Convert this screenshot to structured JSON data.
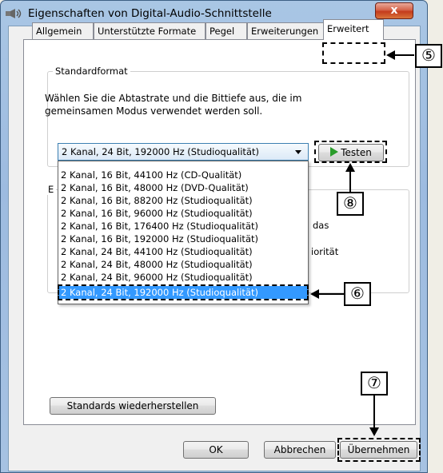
{
  "window": {
    "title": "Eigenschaften von Digital-Audio-Schnittstelle",
    "close_label": "x"
  },
  "tabs": [
    {
      "label": "Allgemein"
    },
    {
      "label": "Unterstützte Formate"
    },
    {
      "label": "Pegel"
    },
    {
      "label": "Erweiterungen"
    },
    {
      "label": "Erweitert"
    }
  ],
  "standardformat": {
    "legend": "Standardformat",
    "description": "Wählen Sie die Abtastrate und die Bittiefe aus, die im gemeinsamen Modus verwendet werden soll.",
    "selected_value": "2 Kanal, 24 Bit, 192000 Hz (Studioqualität)",
    "test_button": "Testen"
  },
  "dropdown": {
    "options": [
      "2 Kanal, 16 Bit, 44100 Hz (CD-Qualität)",
      "2 Kanal, 16 Bit, 48000 Hz (DVD-Qualität)",
      "2 Kanal, 16 Bit, 88200 Hz (Studioqualität)",
      "2 Kanal, 16 Bit, 96000 Hz (Studioqualität)",
      "2 Kanal, 16 Bit, 176400 Hz (Studioqualität)",
      "2 Kanal, 16 Bit, 192000 Hz (Studioqualität)",
      "2 Kanal, 24 Bit, 44100 Hz (Studioqualität)",
      "2 Kanal, 24 Bit, 48000 Hz (Studioqualität)",
      "2 Kanal, 24 Bit, 96000 Hz (Studioqualität)",
      "2 Kanal, 24 Bit, 192000 Hz (Studioqualität)"
    ],
    "selected_index": 9
  },
  "exclusive_group": {
    "legend_fragment": "E",
    "text_fragment_1": "das",
    "text_fragment_2": "iorität"
  },
  "buttons": {
    "restore_defaults": "Standards wiederherstellen",
    "ok": "OK",
    "cancel": "Abbrechen",
    "apply": "Übernehmen"
  },
  "callouts": {
    "c5": "⑤",
    "c6": "⑥",
    "c7": "⑦",
    "c8": "⑧"
  }
}
